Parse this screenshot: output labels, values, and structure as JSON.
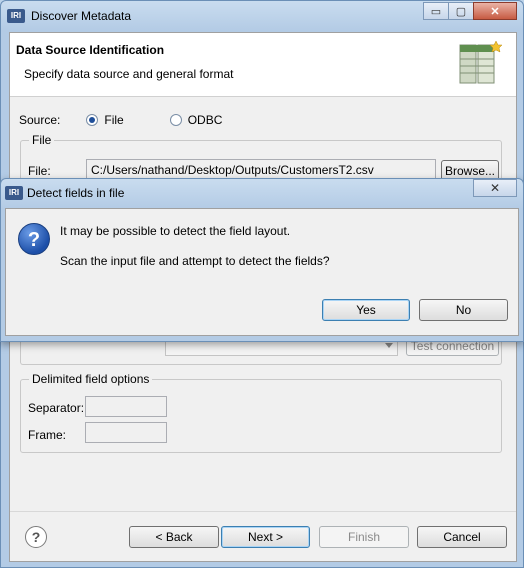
{
  "window": {
    "logo_text": "IRI",
    "title": "Discover Metadata",
    "minimize_glyph": "▭",
    "maximize_glyph": "▢",
    "close_glyph": "✕"
  },
  "header": {
    "title": "Data Source Identification",
    "subtitle": "Specify data source and general format",
    "icon": "table-wizard-icon"
  },
  "source": {
    "label": "Source:",
    "options": [
      {
        "label": "File",
        "selected": true
      },
      {
        "label": "ODBC",
        "selected": false
      }
    ]
  },
  "file_group": {
    "label": "File",
    "file_label": "File:",
    "file_value": "C:/Users/nathand/Desktop/Outputs/CustomersT2.csv",
    "browse_label": "Browse..."
  },
  "odbc": {
    "test_connection_label": "Test connection"
  },
  "delimited": {
    "label": "Delimited field options",
    "separator_label": "Separator:",
    "separator_value": "",
    "frame_label": "Frame:",
    "frame_value": ""
  },
  "footer": {
    "help_glyph": "?",
    "back_label": "< Back",
    "next_label": "Next >",
    "finish_label": "Finish",
    "cancel_label": "Cancel"
  },
  "dialog": {
    "logo_text": "IRI",
    "title": "Detect fields in file",
    "close_glyph": "✕",
    "icon_glyph": "?",
    "message_1": "It may be possible to detect the field layout.",
    "message_2": "Scan the input file and attempt to detect the fields?",
    "yes_label": "Yes",
    "no_label": "No"
  },
  "colors": {
    "accent": "#3c7fb1",
    "title_gradient_top": "#c9dcef",
    "dialog_icon": "#1d4fa8"
  }
}
